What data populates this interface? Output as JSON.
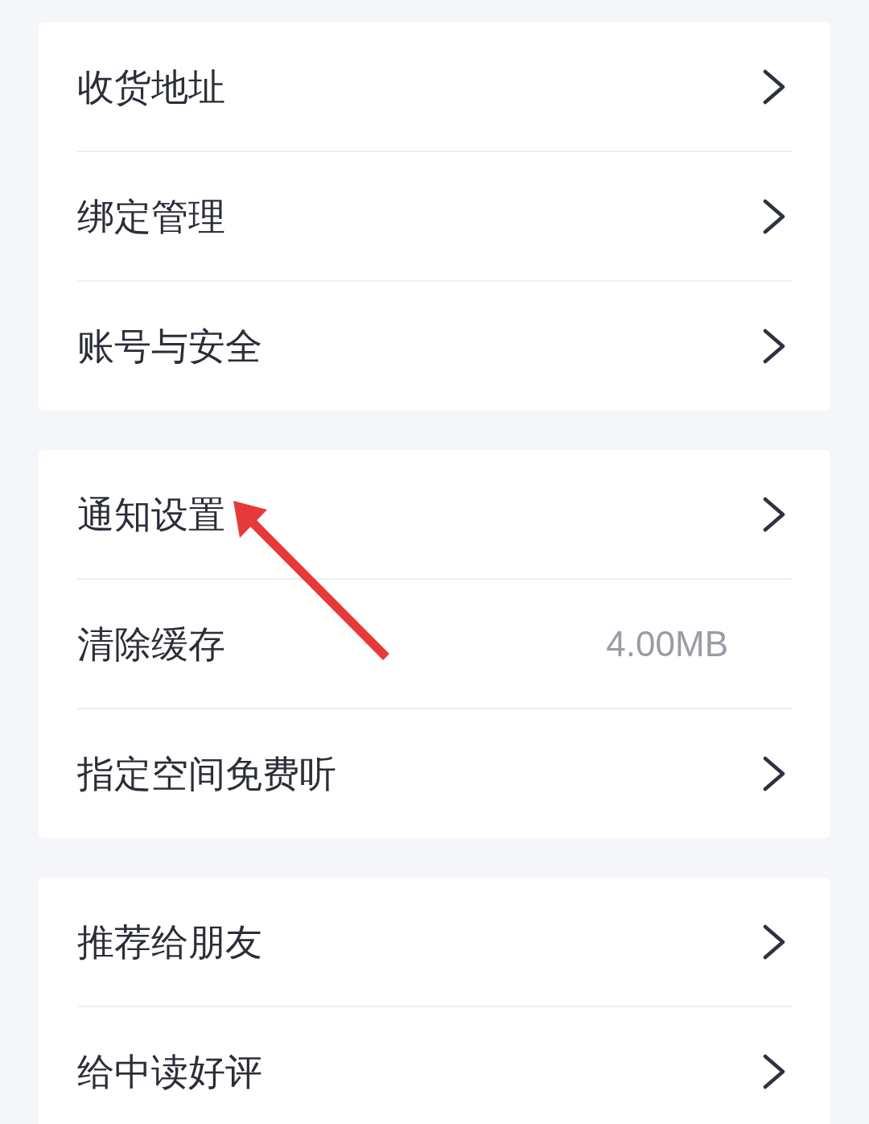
{
  "groups": [
    {
      "items": [
        {
          "label": "收货地址",
          "kind": "link"
        },
        {
          "label": "绑定管理",
          "kind": "link"
        },
        {
          "label": "账号与安全",
          "kind": "link"
        }
      ]
    },
    {
      "items": [
        {
          "label": "通知设置",
          "kind": "link"
        },
        {
          "label": "清除缓存",
          "kind": "value",
          "value": "4.00MB"
        },
        {
          "label": "指定空间免费听",
          "kind": "link"
        }
      ]
    },
    {
      "items": [
        {
          "label": "推荐给朋友",
          "kind": "link"
        },
        {
          "label": "给中读好评",
          "kind": "link"
        }
      ]
    }
  ],
  "annotations": [
    {
      "kind": "arrow"
    }
  ]
}
